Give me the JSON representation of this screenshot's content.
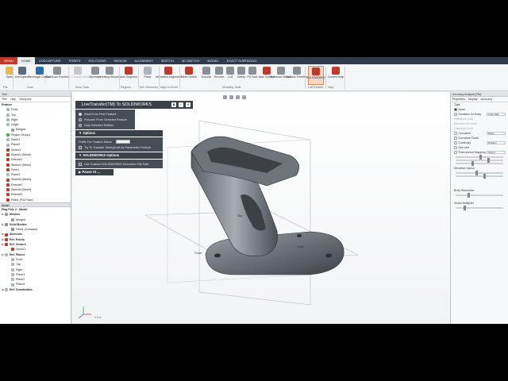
{
  "tabs": [
    "MENU",
    "HOME",
    "LIVECAPTURE",
    "POINTS",
    "POLYGONS",
    "REGION",
    "ALIGNMENT",
    "SKETCH",
    "3D SKETCH",
    "MODEL",
    "EXACT SURFACING"
  ],
  "ribbon": {
    "buttons": [
      {
        "label": "Open",
        "icon": "folder-icon",
        "color": "#e6b84a"
      },
      {
        "label": "LiveCapture",
        "icon": "capture-icon",
        "color": "#5b6b7c"
      },
      {
        "label": "Geomagic Capture",
        "icon": "scanner-icon",
        "color": "#2b6ea6"
      },
      {
        "label": "Run Scan Process",
        "icon": "scan-process-icon",
        "color": "#8a8f96"
      },
      {
        "label": "Mesh Creation Wizard",
        "icon": "mesh-wizard-icon",
        "color": "#c4c8cc",
        "disabled": true
      },
      {
        "label": "Decimate",
        "icon": "decimate-icon",
        "color": "#8a8f96"
      },
      {
        "label": "Healing Wizard",
        "icon": "healing-icon",
        "color": "#8a8f96"
      },
      {
        "label": "Auto Segment",
        "icon": "segment-icon",
        "color": "#c0392b"
      },
      {
        "label": "Plane",
        "icon": "plane-icon",
        "color": "#aab4bf"
      },
      {
        "label": "Interactive Alignment",
        "icon": "align-icon",
        "color": "#c0392b"
      },
      {
        "label": "Mesh Sketch",
        "icon": "mesh-sketch-icon",
        "color": "#c0392b"
      },
      {
        "label": "Extrude",
        "icon": "extrude-icon",
        "color": "#8a8f96"
      },
      {
        "label": "Revolve",
        "icon": "revolve-icon",
        "color": "#8a8f96"
      },
      {
        "label": "Loft",
        "icon": "loft-icon",
        "color": "#8a8f96"
      },
      {
        "label": "Sweep",
        "icon": "sweep-icon",
        "color": "#8a8f96"
      },
      {
        "label": "Fill Face",
        "icon": "fill-face-icon",
        "color": "#8a8f96"
      },
      {
        "label": "Auto Surface",
        "icon": "auto-surface-icon",
        "color": "#c0392b"
      },
      {
        "label": "Extrusion Wizard",
        "icon": "extrusion-wizard-icon",
        "color": "#8a8f96"
      },
      {
        "label": "Surface Primitive",
        "icon": "primitive-icon",
        "color": "#8a8f96"
      },
      {
        "label": "SOLIDWORKS",
        "icon": "solidworks-icon",
        "color": "#c0392b"
      },
      {
        "label": "Context Help",
        "icon": "help-icon",
        "color": "#c0392b"
      }
    ],
    "groups": [
      "File",
      "Scan",
      "Scan Tools",
      "Regions",
      "Ref. Geometry",
      "Align to World",
      "Modeling Tools",
      "LiveTransfer",
      "Help"
    ]
  },
  "left_panel": {
    "header": "Tree",
    "tabs": [
      "Tree",
      "Help",
      "Viewpoint"
    ],
    "feature_title": "Feature",
    "features": [
      {
        "label": "Front",
        "color": "#b0b6bd"
      },
      {
        "label": "Top",
        "color": "#b0b6bd"
      },
      {
        "label": "Right",
        "color": "#b0b6bd"
      },
      {
        "label": "Origin",
        "color": "#b0b6bd"
      },
      {
        "label": "Merged",
        "color": "#8fa0b3"
      },
      {
        "label": "Region Group1",
        "color": "#4caf50"
      },
      {
        "label": "Plane1",
        "color": "#b0b6bd"
      },
      {
        "label": "Plane2",
        "color": "#b0b6bd"
      },
      {
        "label": "Vector1",
        "color": "#c0392b"
      },
      {
        "label": "Sketch1 (Mesh)",
        "color": "#c0392b"
      },
      {
        "label": "Extrude1",
        "color": "#c0392b"
      },
      {
        "label": "Sketch2 (Mesh)",
        "color": "#c0392b"
      },
      {
        "label": "Point1",
        "color": "#c0392b"
      },
      {
        "label": "Plane3",
        "color": "#b0b6bd"
      },
      {
        "label": "Sketch3 (Mesh)",
        "color": "#c0392b"
      },
      {
        "label": "Extrude2",
        "color": "#c0392b"
      },
      {
        "label": "Sketch4 (Mesh)",
        "color": "#c0392b"
      },
      {
        "label": "Extrude3",
        "color": "#c0392b"
      },
      {
        "label": "Fillet1 (Full Face)",
        "color": "#c0392b"
      }
    ],
    "model_title": "Model",
    "model_root": "Flag Pole 2 - Model",
    "model": [
      {
        "label": "Meshes",
        "color": "#8fa0b3",
        "bold": true
      },
      {
        "label": "Merged",
        "color": "#8fa0b3"
      },
      {
        "label": "Solid Bodies",
        "color": "#8a8f96",
        "bold": true
      },
      {
        "label": "Fillet1 (Constant)",
        "color": "#8a8f96"
      },
      {
        "label": "Sketches",
        "color": "#c0392b",
        "bold": true
      },
      {
        "label": "Ref. Points",
        "color": "#c0392b",
        "bold": true
      },
      {
        "label": "Ref. Vectors",
        "color": "#c0392b",
        "bold": true
      },
      {
        "label": "Vector1",
        "color": "#c0392b"
      },
      {
        "label": "Ref. Planes",
        "color": "#b0b6bd",
        "bold": true
      },
      {
        "label": "Front",
        "color": "#b0b6bd"
      },
      {
        "label": "Top",
        "color": "#b0b6bd"
      },
      {
        "label": "Right",
        "color": "#b0b6bd"
      },
      {
        "label": "Plane1",
        "color": "#b0b6bd"
      },
      {
        "label": "Plane2",
        "color": "#b0b6bd"
      },
      {
        "label": "Plane3",
        "color": "#b0b6bd"
      },
      {
        "label": "Ref. Coordinates",
        "color": "#b0b6bd",
        "bold": true
      }
    ]
  },
  "live_transfer": {
    "title": "LiveTransfer(TM) To SOLIDWORKS",
    "options": [
      {
        "label": "Start From First Feature",
        "selected": true
      },
      {
        "label": "Resume From Selected Feature",
        "selected": false
      },
      {
        "label": "Only Selected Entities",
        "selected": false
      }
    ],
    "options_title": "Options",
    "prefix_label": "Prefix For Feature Name",
    "try_transfer": "Try To Transfer Sweep/Loft as Parametric Feature",
    "sw_options_title": "SOLIDWORKS Options",
    "custom_exec": "Use Custom SOLIDWORKS Execution File Path",
    "pause_title": "Pause At ..."
  },
  "viewport": {
    "labels": [
      "Top",
      "Front",
      "Right"
    ],
    "scale": "0.0 in"
  },
  "right_panel": {
    "title": "Accuracy Analyzer(TM)",
    "tabs": [
      "Properties",
      "Display",
      "Accuracy"
    ],
    "type_label": "Type",
    "none_label": "None",
    "deviation_body": "Deviation for Body",
    "color_map": "Color Map",
    "dim_rows": [
      "Tolerance Limit",
      "Deviation for Mesh",
      "Tolerance Limit"
    ],
    "curvature": "Curvature",
    "mean": "Mean",
    "curvature_comb": "Curvature Comb",
    "continuity": "Continuity",
    "position": "Position",
    "environment_mapping": "Environment Mapping",
    "object": "Object",
    "see_line": "See Line",
    "deviation_option": "Deviation Option",
    "body_resolution": "Body Resolution",
    "vector_multiplier": "Vector Multiplier"
  }
}
